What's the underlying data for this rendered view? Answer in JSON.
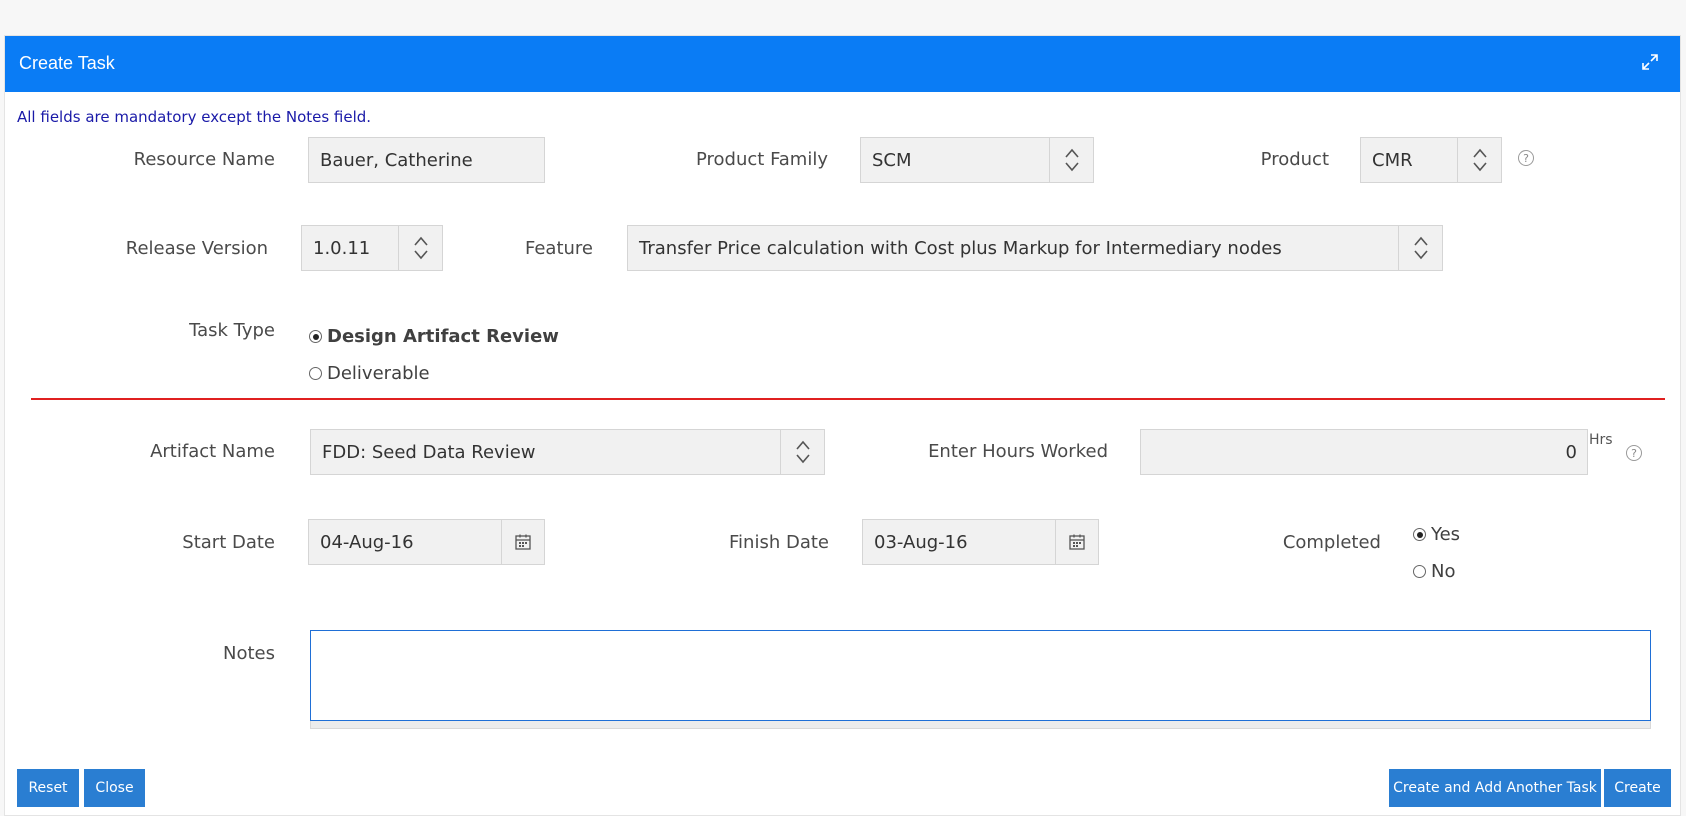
{
  "dialog": {
    "title": "Create Task",
    "maximize_icon": "expand-icon"
  },
  "note": "All fields are mandatory except the Notes field.",
  "resource": {
    "label": "Resource Name",
    "value": "Bauer, Catherine"
  },
  "product_family": {
    "label": "Product Family",
    "value": "SCM"
  },
  "product": {
    "label": "Product",
    "value": "CMR",
    "help": "?"
  },
  "release_version": {
    "label": "Release Version",
    "value": "1.0.11"
  },
  "feature": {
    "label": "Feature",
    "value": "Transfer Price calculation with Cost plus Markup for Intermediary nodes"
  },
  "task_type": {
    "label": "Task Type",
    "options": [
      {
        "label": "Design Artifact Review",
        "selected": true
      },
      {
        "label": "Deliverable",
        "selected": false
      }
    ]
  },
  "artifact": {
    "label": "Artifact Name",
    "value": "FDD: Seed Data Review"
  },
  "hours": {
    "label": "Enter Hours Worked",
    "value": "0",
    "unit": "Hrs",
    "help": "?"
  },
  "start_date": {
    "label": "Start Date",
    "value": "04-Aug-16"
  },
  "finish_date": {
    "label": "Finish Date",
    "value": "03-Aug-16"
  },
  "completed": {
    "label": "Completed",
    "options": [
      {
        "label": "Yes",
        "selected": true
      },
      {
        "label": "No",
        "selected": false
      }
    ]
  },
  "notes": {
    "label": "Notes",
    "value": ""
  },
  "buttons": {
    "reset": "Reset",
    "close": "Close",
    "create_another": "Create and Add Another Task",
    "create": "Create"
  },
  "colors": {
    "header": "#0a7cf5",
    "button": "#2a7ed2",
    "divider": "#e02020",
    "note_text": "#1a1aa8"
  }
}
